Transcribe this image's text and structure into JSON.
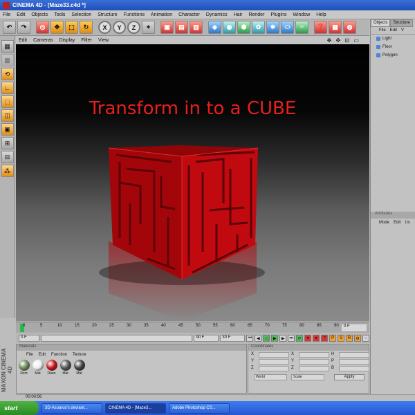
{
  "window": {
    "title": "CINEMA 4D - [Maze33.c4d *]"
  },
  "menubar": [
    "File",
    "Edit",
    "Objects",
    "Tools",
    "Selection",
    "Structure",
    "Functions",
    "Animation",
    "Character",
    "Dynamics",
    "Hair",
    "Render",
    "Plugins",
    "Window",
    "Help"
  ],
  "toolbar": {
    "axis_x": "X",
    "axis_y": "Y",
    "axis_z": "Z"
  },
  "viewport": {
    "menu": [
      "Edit",
      "Cameras",
      "Display",
      "Filter",
      "View"
    ],
    "nav_icons": "✥ ✜ ⊡ ▭",
    "overlay_text": "Transform in to a CUBE",
    "overlay_color": "#e81f1f",
    "cube_color": "#b3060b"
  },
  "objects_panel": {
    "tabs": [
      "Objects",
      "Structure"
    ],
    "menu": [
      "File",
      "Edit",
      "V"
    ],
    "items": [
      "Light",
      "Floor",
      "Polygon"
    ]
  },
  "attributes_panel": {
    "title": "Attributes",
    "menu": [
      "Mode",
      "Edit",
      "Us"
    ]
  },
  "timeline": {
    "ticks": [
      "0",
      "5",
      "10",
      "15",
      "20",
      "25",
      "30",
      "35",
      "40",
      "45",
      "50",
      "55",
      "60",
      "65",
      "70",
      "75",
      "80",
      "85",
      "90"
    ],
    "end_frame": "0 F"
  },
  "transport": {
    "start": "0 F",
    "end": "90 F",
    "fps": "30 F"
  },
  "materials": {
    "title": "Materials",
    "menu": [
      "File",
      "Edit",
      "Function",
      "Texture"
    ],
    "items": [
      {
        "label": "Rect",
        "color": "#6f8a5a"
      },
      {
        "label": "Mat",
        "color": "#eeeeee"
      },
      {
        "label": "Dane",
        "color": "#c8141a"
      },
      {
        "label": "Mat",
        "color": "#555555"
      },
      {
        "label": "Mat",
        "color": "#444444"
      }
    ]
  },
  "branding": {
    "logo": "MAXON CINEMA 4D"
  },
  "coordinates": {
    "title": "Coordinates",
    "rows": [
      {
        "a": "X",
        "b": "X",
        "c": "H"
      },
      {
        "a": "Y",
        "b": "Y",
        "c": "P"
      },
      {
        "a": "Z",
        "b": "Z",
        "c": "B"
      }
    ],
    "mode1": "World",
    "mode2": "Scale",
    "apply": "Apply"
  },
  "status": {
    "text": "00:00:56"
  },
  "taskbar": {
    "start": "start",
    "tasks": [
      "3D-Asuarus's deviant...",
      "CINEMA 4D - [Maze3...",
      "Adobe Photoshop CS..."
    ]
  }
}
